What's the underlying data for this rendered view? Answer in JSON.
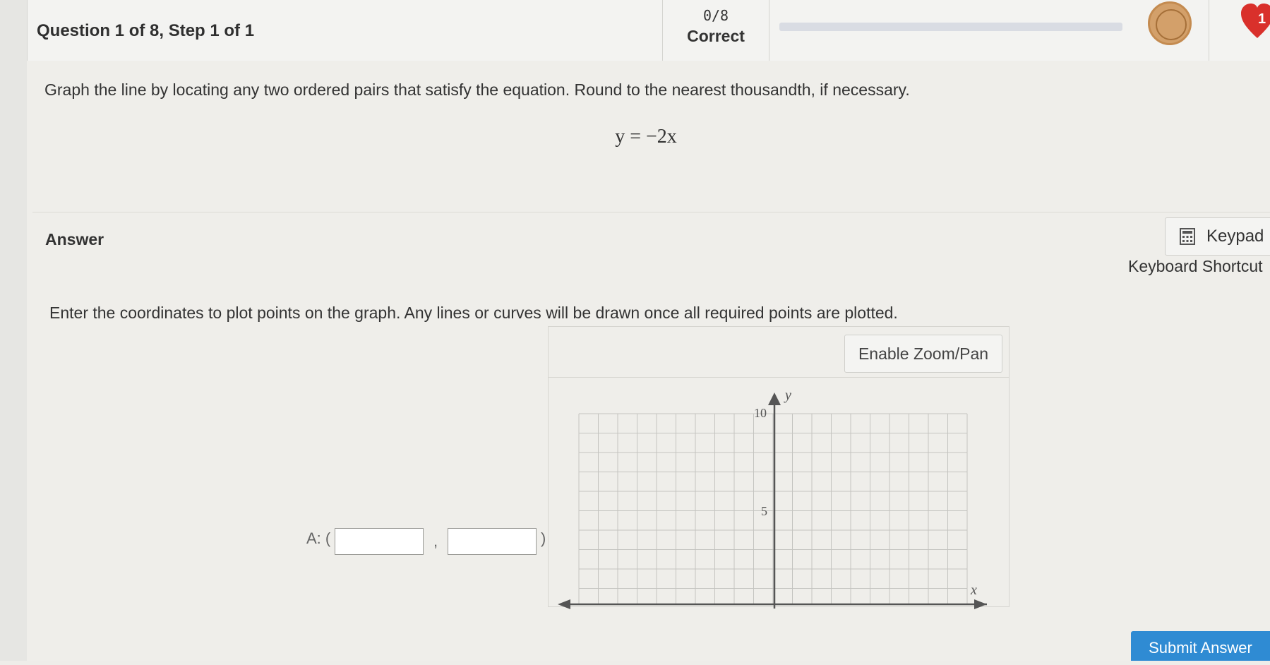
{
  "header": {
    "question_title": "Question 1 of 8, Step 1 of 1",
    "score_fraction": "0/8",
    "score_label": "Correct",
    "hearts_count": "1"
  },
  "question": {
    "prompt": "Graph the line by locating any two ordered pairs that satisfy the equation. Round to the nearest thousandth, if necessary.",
    "equation": "y = −2x"
  },
  "answer": {
    "label": "Answer",
    "keypad_label": "Keypad",
    "keyboard_shortcuts_label": "Keyboard Shortcut",
    "instructions": "Enter the coordinates to plot points on the graph. Any lines or curves will be drawn once all required points are plotted.",
    "zoom_button_label": "Enable Zoom/Pan",
    "point_label": "A: (",
    "separator": ",",
    "close_paren": ")",
    "x_value": "",
    "y_value": ""
  },
  "graph": {
    "x_axis_label": "x",
    "y_axis_label": "y",
    "y_tick_10": "10",
    "y_tick_5": "5"
  },
  "footer": {
    "submit_label": "Submit Answer"
  },
  "colors": {
    "accent": "#2f8bd3",
    "heart": "#d9302b",
    "medal": "#d3a06a"
  }
}
